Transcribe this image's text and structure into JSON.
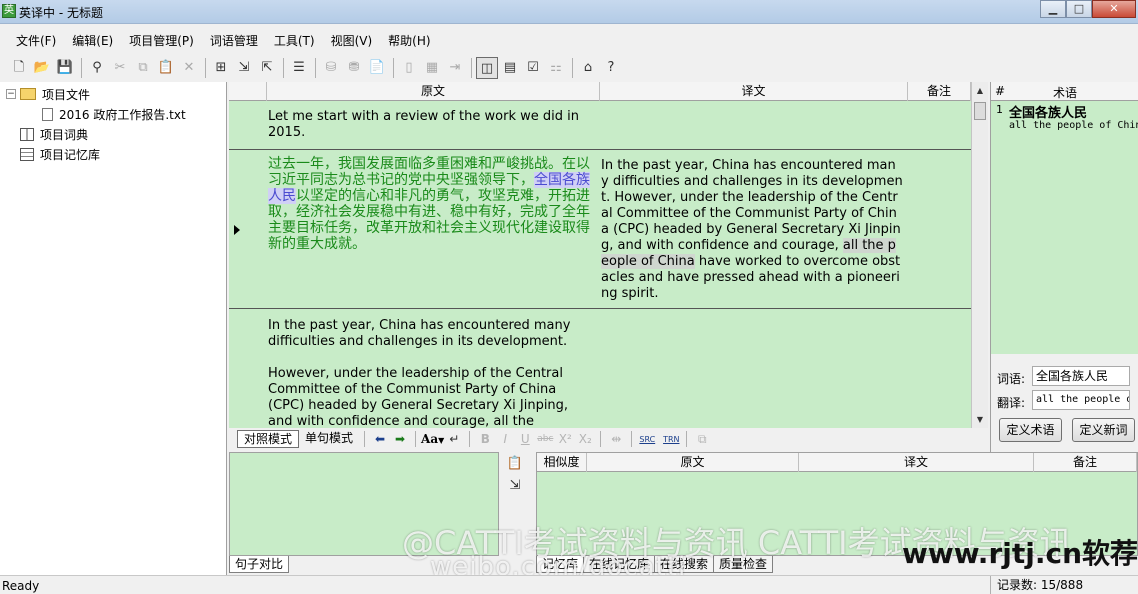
{
  "window": {
    "app_icon": "英",
    "title": "英译中 - 无标题",
    "buttons": [
      "minimize-icon",
      "maximize-icon",
      "close-icon"
    ]
  },
  "menu": [
    "文件(F)",
    "编辑(E)",
    "项目管理(P)",
    "词语管理",
    "工具(T)",
    "视图(V)",
    "帮助(H)"
  ],
  "tree": {
    "root": "项目文件",
    "file": "2016 政府工作报告.txt",
    "dict": "项目词典",
    "memory": "项目记忆库"
  },
  "grid": {
    "headers": {
      "source": "原文",
      "target": "译文",
      "note": "备注"
    },
    "rows": [
      {
        "source": "Let me start with a review of the work we did in 2015.",
        "target": ""
      },
      {
        "source_before": "过去一年，我国发展面临多重困难和严峻挑战。在以习近平同志为总书记的党中央坚强领导下，",
        "source_term": "全国各族人民",
        "source_after": "以坚定的信心和非凡的勇气，攻坚克难，开拓进取，经济社会发展稳中有进、稳中有好，完成了全年主要目标任务，改革开放和社会主义现代化建设取得新的重大成就。",
        "target_before": "In the past year, China has encountered many difficulties and challenges in its development. However, under the leadership of the Central Committee of the Communist Party of China (CPC) headed by General Secretary Xi Jinping, and with confidence and courage, ",
        "target_term": "all the people of China",
        "target_after": " have worked to overcome obstacles and have pressed ahead with a pioneering spirit."
      },
      {
        "source_p1": "In the past year, China has encountered many difficulties and challenges in its development.",
        "source_p2": "However, under the leadership of the Central Committee of the Communist Party of China (CPC) headed by General Secretary Xi Jinping, and with confidence and courage, all the",
        "target": ""
      }
    ]
  },
  "term_panel": {
    "headers": {
      "num": "#",
      "term": "术语"
    },
    "rows": [
      {
        "num": "1",
        "source": "全国各族人民",
        "target": "all the people of China"
      }
    ],
    "word_label": "词语:",
    "word_value": "全国各族人民",
    "translation_label": "翻译:",
    "translation_value": "all the people of China",
    "define_term_button": "定义术语",
    "define_word_button": "定义新词"
  },
  "mode_bar": {
    "compare_mode": "对照模式",
    "sentence_mode": "单句模式",
    "font_label": "Aa",
    "src_label": "SRC",
    "trn_label": "TRN"
  },
  "bottom": {
    "headers": {
      "similarity": "相似度",
      "source": "原文",
      "target": "译文",
      "note": "备注"
    },
    "left_tabs": [
      "句子对比"
    ],
    "right_tabs": [
      "记忆库",
      "在线记忆库",
      "在线搜索",
      "质量检查"
    ]
  },
  "watermarks": {
    "line1": "@CATTI考试资料与资讯  CATTI考试资料与资讯",
    "line2": "weibo.com/gocatti",
    "line3": "www.rjtj.cn软荐网"
  },
  "status": {
    "left": "Ready",
    "right": "记录数: 15/888"
  },
  "colors": {
    "grid_bg": "#c8ecc8",
    "chinese_text": "#1a8a1a",
    "term_highlight": "#4b4bd0"
  }
}
